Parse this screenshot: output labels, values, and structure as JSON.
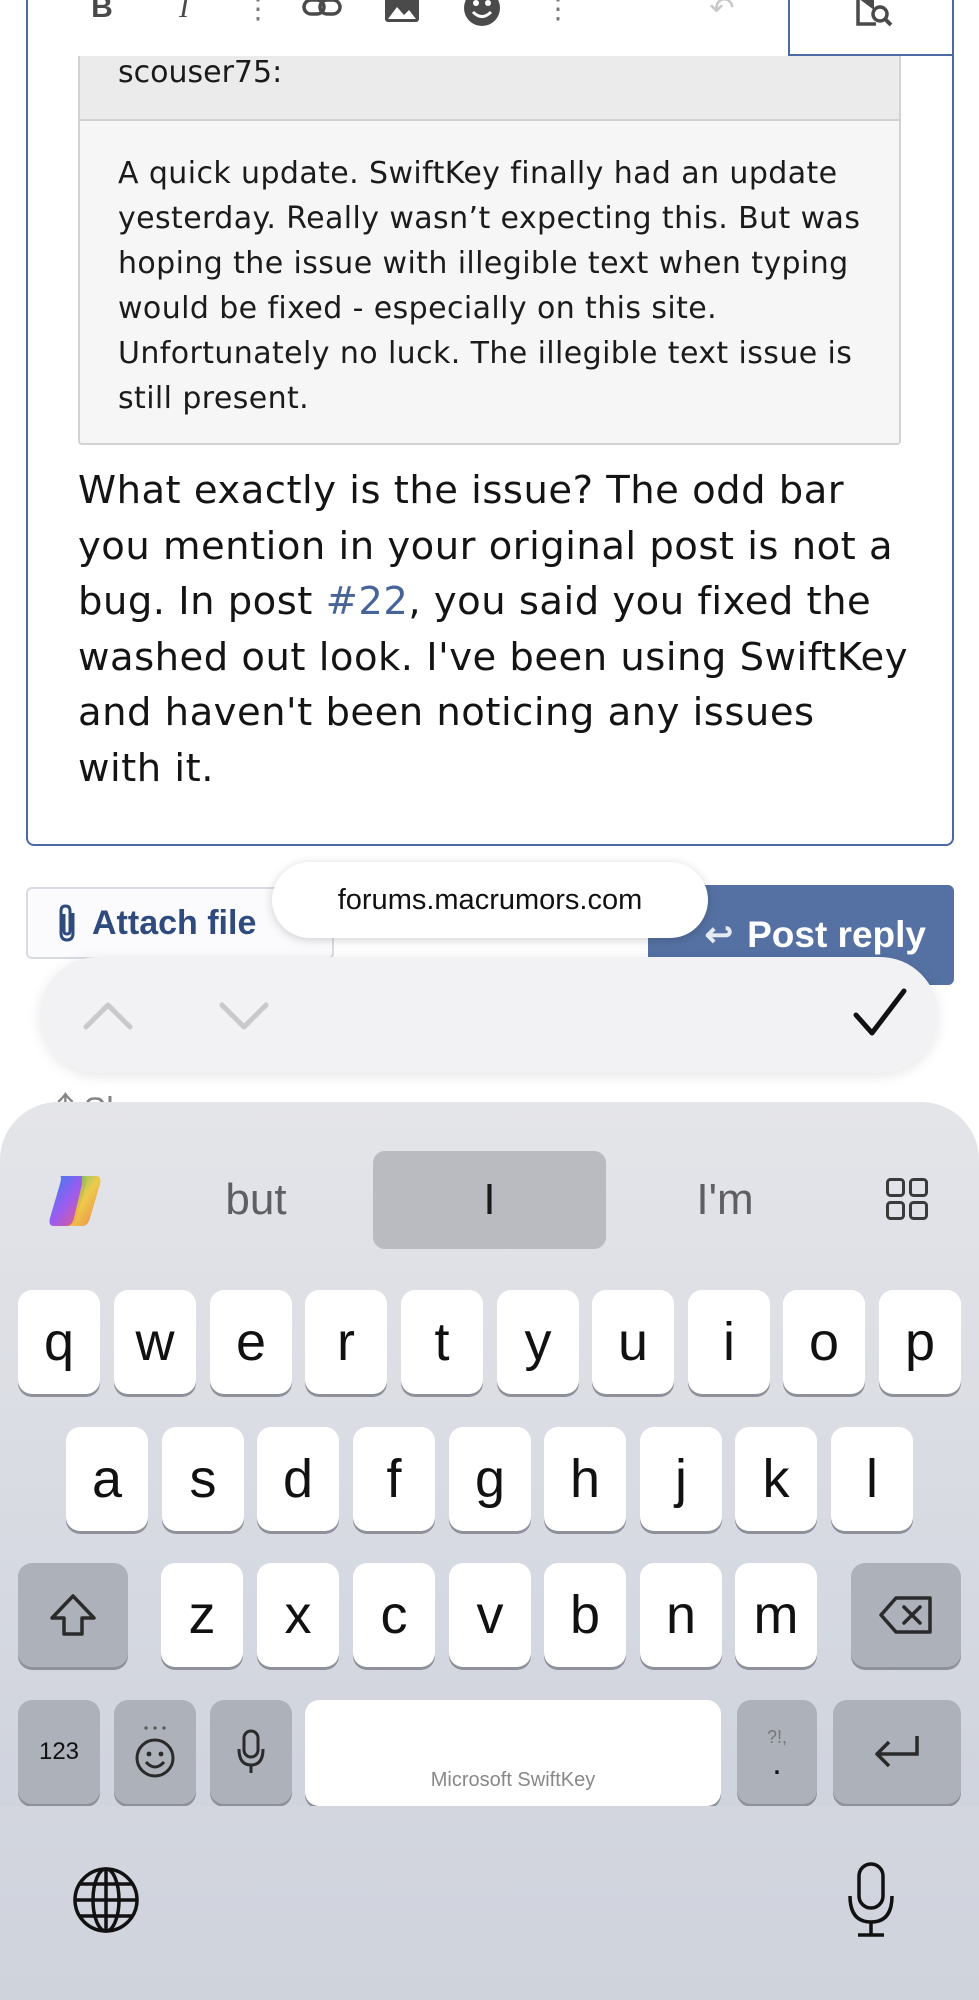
{
  "editor": {
    "quote_author": "scouser75:",
    "quote_text": "A quick update. SwiftKey finally had an update yesterday. Really wasn’t expecting this. But was hoping the issue with illegible text when typing would be fixed - especially on this site. Unfortunately no luck. The illegible text issue is still present.",
    "reply_part1": "What exactly is the issue? The odd bar you mention in your original post is not a bug. In post ",
    "reply_link": "#22",
    "reply_part2": ", you said you fixed the washed out look. I've been using SwiftKey and haven't been noticing any issues with it."
  },
  "actions": {
    "attach_label": "Attach file",
    "post_reply_label": "Post reply",
    "share_label": "Share"
  },
  "url_pill": "forums.macrumors.com",
  "keyboard": {
    "suggestions": [
      "but",
      "I",
      "I'm"
    ],
    "row1": [
      "q",
      "w",
      "e",
      "r",
      "t",
      "y",
      "u",
      "i",
      "o",
      "p"
    ],
    "row2": [
      "a",
      "s",
      "d",
      "f",
      "g",
      "h",
      "j",
      "k",
      "l"
    ],
    "row3": [
      "z",
      "x",
      "c",
      "v",
      "b",
      "n",
      "m"
    ],
    "num_key": "123",
    "space_label": "Microsoft SwiftKey",
    "punct_top": "?!,",
    "punct_bottom": "."
  },
  "colors": {
    "border_accent": "#4b6aa5",
    "post_button": "#5571a3",
    "link": "#47649a"
  }
}
